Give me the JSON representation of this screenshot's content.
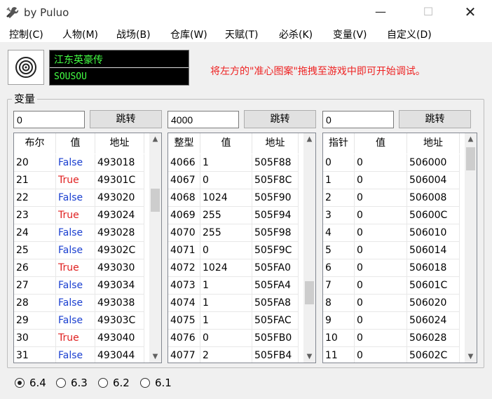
{
  "window": {
    "title": "by Puluo"
  },
  "menu": [
    "控制(C)",
    "人物(M)",
    "战场(B)",
    "仓库(W)",
    "天赋(T)",
    "必杀(K)",
    "变量(V)",
    "自定义(D)"
  ],
  "player": {
    "game_name": "江东英豪传",
    "alias": "SOUSOU"
  },
  "hint": "将左方的\"准心图案\"拖拽至游戏中即可开始调试。",
  "group_label": "变量",
  "panels": [
    {
      "address": "0",
      "jump_label": "跳转",
      "headers": [
        "布尔",
        "值",
        "地址"
      ],
      "rows": [
        [
          "20",
          "False",
          "493018"
        ],
        [
          "21",
          "True",
          "49301C"
        ],
        [
          "22",
          "False",
          "493020"
        ],
        [
          "23",
          "True",
          "493024"
        ],
        [
          "24",
          "False",
          "493028"
        ],
        [
          "25",
          "False",
          "49302C"
        ],
        [
          "26",
          "True",
          "493030"
        ],
        [
          "27",
          "False",
          "493034"
        ],
        [
          "28",
          "False",
          "493038"
        ],
        [
          "29",
          "False",
          "49303C"
        ],
        [
          "30",
          "True",
          "493040"
        ],
        [
          "31",
          "False",
          "493044"
        ]
      ]
    },
    {
      "address": "4000",
      "jump_label": "跳转",
      "headers": [
        "整型",
        "值",
        "地址"
      ],
      "rows": [
        [
          "4066",
          "1",
          "505F88"
        ],
        [
          "4067",
          "0",
          "505F8C"
        ],
        [
          "4068",
          "1024",
          "505F90"
        ],
        [
          "4069",
          "255",
          "505F94"
        ],
        [
          "4070",
          "255",
          "505F98"
        ],
        [
          "4071",
          "0",
          "505F9C"
        ],
        [
          "4072",
          "1024",
          "505FA0"
        ],
        [
          "4073",
          "1",
          "505FA4"
        ],
        [
          "4074",
          "1",
          "505FA8"
        ],
        [
          "4075",
          "1",
          "505FAC"
        ],
        [
          "4076",
          "0",
          "505FB0"
        ],
        [
          "4077",
          "2",
          "505FB4"
        ]
      ]
    },
    {
      "address": "0",
      "jump_label": "跳转",
      "headers": [
        "指针",
        "值",
        "地址"
      ],
      "rows": [
        [
          "0",
          "0",
          "506000"
        ],
        [
          "1",
          "0",
          "506004"
        ],
        [
          "2",
          "0",
          "506008"
        ],
        [
          "3",
          "0",
          "50600C"
        ],
        [
          "4",
          "0",
          "506010"
        ],
        [
          "5",
          "0",
          "506014"
        ],
        [
          "6",
          "0",
          "506018"
        ],
        [
          "7",
          "0",
          "50601C"
        ],
        [
          "8",
          "0",
          "506020"
        ],
        [
          "9",
          "0",
          "506024"
        ],
        [
          "10",
          "0",
          "506028"
        ],
        [
          "11",
          "0",
          "50602C"
        ]
      ]
    }
  ],
  "versions": [
    {
      "label": "6.4",
      "selected": true
    },
    {
      "label": "6.3",
      "selected": false
    },
    {
      "label": "6.2",
      "selected": false
    },
    {
      "label": "6.1",
      "selected": false
    }
  ],
  "colors": {
    "true_color": "#e02020",
    "false_color": "#1a3fd0",
    "name_text": "#44ff44",
    "hint_text": "#ee2222"
  }
}
